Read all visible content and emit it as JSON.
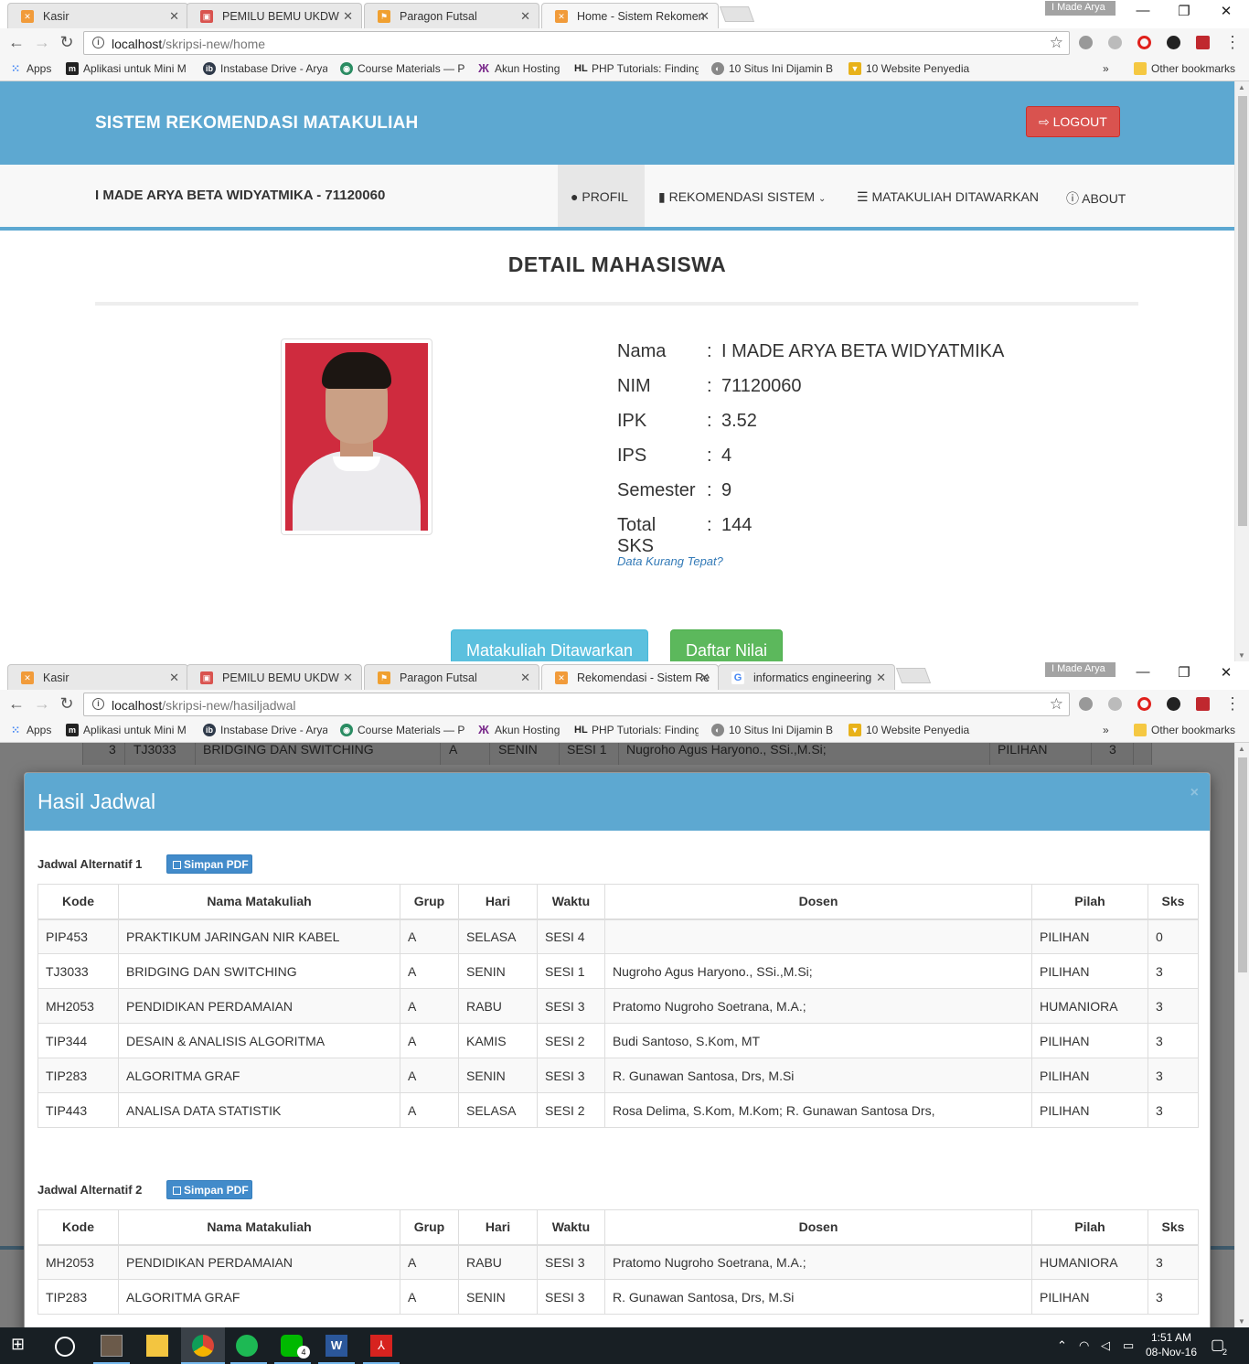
{
  "window1": {
    "tabs": [
      {
        "title": "Kasir",
        "icon": "xampp-icon"
      },
      {
        "title": "PEMILU BEMU UKDW",
        "icon": "gift-icon"
      },
      {
        "title": "Paragon Futsal",
        "icon": "futsal-icon"
      },
      {
        "title": "Home - Sistem Rekomen",
        "icon": "xampp-icon"
      }
    ],
    "user_badge": "I Made Arya",
    "url_host": "localhost",
    "url_path": "/skripsi-new/home",
    "bookmarks": [
      "Apps",
      "Aplikasi untuk Mini M",
      "Instabase Drive - Arya",
      "Course Materials — P",
      "Akun Hosting",
      "PHP Tutorials: Finding",
      "10 Situs Ini Dijamin B",
      "10 Website Penyedia"
    ],
    "bookmarks_more": "»",
    "other_bookmarks": "Other bookmarks",
    "page": {
      "brand": "SISTEM REKOMENDASI MATAKULIAH",
      "logout_label": "LOGOUT",
      "user_name": "I MADE ARYA BETA WIDYATMIKA - 71120060",
      "nav": {
        "profil": "PROFIL",
        "rekomendasi": "REKOMENDASI SISTEM",
        "matakuliah": "MATAKULIAH DITAWARKAN",
        "about": "ABOUT"
      },
      "detail_title": "DETAIL MAHASISWA",
      "separator": ":",
      "info": [
        {
          "label": "Nama",
          "value": "I MADE ARYA BETA WIDYATMIKA"
        },
        {
          "label": "NIM",
          "value": "71120060"
        },
        {
          "label": "IPK",
          "value": "3.52"
        },
        {
          "label": "IPS",
          "value": "4"
        },
        {
          "label": "Semester",
          "value": "9"
        },
        {
          "label": "Total SKS",
          "value": "144"
        }
      ],
      "data_kurang": "Data Kurang Tepat?",
      "btn_matakuliah": "Matakuliah Ditawarkan",
      "btn_nilai": "Daftar Nilai"
    }
  },
  "window2": {
    "tabs": [
      {
        "title": "Kasir",
        "icon": "xampp-icon"
      },
      {
        "title": "PEMILU BEMU UKDW",
        "icon": "gift-icon"
      },
      {
        "title": "Paragon Futsal",
        "icon": "futsal-icon"
      },
      {
        "title": "Rekomendasi - Sistem Re",
        "icon": "xampp-icon"
      },
      {
        "title": "informatics engineering",
        "icon": "google-icon"
      }
    ],
    "user_badge": "I Made Arya",
    "url_host": "localhost",
    "url_path": "/skripsi-new/hasiljadwal",
    "background_row": [
      "3",
      "TJ3033",
      "BRIDGING DAN SWITCHING",
      "A",
      "SENIN",
      "SESI 1",
      "Nugroho Agus Haryono., SSi.,M.Si;",
      "PILIHAN",
      "3"
    ],
    "modal": {
      "title": "Hasil Jadwal",
      "close": "×",
      "pdf_label": "Simpan PDF",
      "columns": [
        "Kode",
        "Nama Matakuliah",
        "Grup",
        "Hari",
        "Waktu",
        "Dosen",
        "Pilah",
        "Sks"
      ],
      "alt1": {
        "label": "Jadwal Alternatif 1",
        "rows": [
          [
            "PIP453",
            "PRAKTIKUM JARINGAN NIR KABEL",
            "A",
            "SELASA",
            "SESI 4",
            "",
            "PILIHAN",
            "0"
          ],
          [
            "TJ3033",
            "BRIDGING DAN SWITCHING",
            "A",
            "SENIN",
            "SESI 1",
            "Nugroho Agus Haryono., SSi.,M.Si;",
            "PILIHAN",
            "3"
          ],
          [
            "MH2053",
            "PENDIDIKAN PERDAMAIAN",
            "A",
            "RABU",
            "SESI 3",
            "Pratomo Nugroho Soetrana, M.A.;",
            "HUMANIORA",
            "3"
          ],
          [
            "TIP344",
            "DESAIN & ANALISIS ALGORITMA",
            "A",
            "KAMIS",
            "SESI 2",
            "Budi Santoso, S.Kom, MT",
            "PILIHAN",
            "3"
          ],
          [
            "TIP283",
            "ALGORITMA GRAF",
            "A",
            "SENIN",
            "SESI 3",
            "R. Gunawan Santosa, Drs, M.Si",
            "PILIHAN",
            "3"
          ],
          [
            "TIP443",
            "ANALISA DATA STATISTIK",
            "A",
            "SELASA",
            "SESI 2",
            "Rosa Delima, S.Kom, M.Kom; R. Gunawan Santosa Drs,",
            "PILIHAN",
            "3"
          ]
        ]
      },
      "alt2": {
        "label": "Jadwal Alternatif 2",
        "rows": [
          [
            "MH2053",
            "PENDIDIKAN PERDAMAIAN",
            "A",
            "RABU",
            "SESI 3",
            "Pratomo Nugroho Soetrana, M.A.;",
            "HUMANIORA",
            "3"
          ],
          [
            "TIP283",
            "ALGORITMA GRAF",
            "A",
            "SENIN",
            "SESI 3",
            "R. Gunawan Santosa, Drs, M.Si",
            "PILIHAN",
            "3"
          ]
        ]
      }
    }
  },
  "taskbar": {
    "time": "1:51 AM",
    "date": "08-Nov-16",
    "chat_badge": "4",
    "notif_count": "2"
  },
  "colors": {
    "header_blue": "#5da8d1",
    "logout_red": "#d9534f",
    "btn_info": "#5bc0de",
    "btn_success": "#5cb85c",
    "pdf_blue": "#428bca"
  }
}
